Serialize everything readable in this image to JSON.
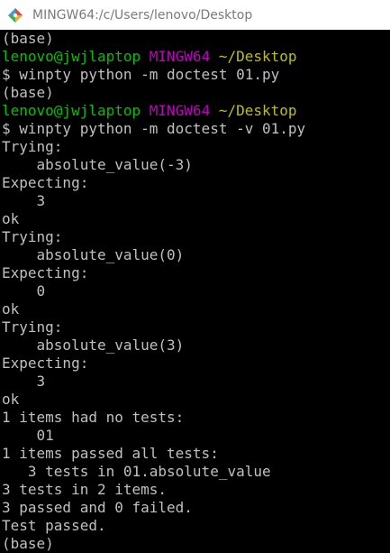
{
  "window": {
    "title": "MINGW64:/c/Users/lenovo/Desktop",
    "icon": "git-bash-icon"
  },
  "terminal": {
    "lines": [
      {
        "kind": "plain",
        "text": "(base)"
      },
      {
        "kind": "prompt",
        "user": "lenovo@jwjlaptop",
        "env": "MINGW64",
        "path": "~/Desktop"
      },
      {
        "kind": "plain",
        "text": "$ winpty python -m doctest 01.py"
      },
      {
        "kind": "plain",
        "text": "(base)"
      },
      {
        "kind": "prompt",
        "user": "lenovo@jwjlaptop",
        "env": "MINGW64",
        "path": "~/Desktop"
      },
      {
        "kind": "plain",
        "text": "$ winpty python -m doctest -v 01.py"
      },
      {
        "kind": "plain",
        "text": "Trying:"
      },
      {
        "kind": "plain",
        "text": "    absolute_value(-3)"
      },
      {
        "kind": "plain",
        "text": "Expecting:"
      },
      {
        "kind": "plain",
        "text": "    3"
      },
      {
        "kind": "plain",
        "text": "ok"
      },
      {
        "kind": "plain",
        "text": "Trying:"
      },
      {
        "kind": "plain",
        "text": "    absolute_value(0)"
      },
      {
        "kind": "plain",
        "text": "Expecting:"
      },
      {
        "kind": "plain",
        "text": "    0"
      },
      {
        "kind": "plain",
        "text": "ok"
      },
      {
        "kind": "plain",
        "text": "Trying:"
      },
      {
        "kind": "plain",
        "text": "    absolute_value(3)"
      },
      {
        "kind": "plain",
        "text": "Expecting:"
      },
      {
        "kind": "plain",
        "text": "    3"
      },
      {
        "kind": "plain",
        "text": "ok"
      },
      {
        "kind": "plain",
        "text": "1 items had no tests:"
      },
      {
        "kind": "plain",
        "text": "    01"
      },
      {
        "kind": "plain",
        "text": "1 items passed all tests:"
      },
      {
        "kind": "plain",
        "text": "   3 tests in 01.absolute_value"
      },
      {
        "kind": "plain",
        "text": "3 tests in 2 items."
      },
      {
        "kind": "plain",
        "text": "3 passed and 0 failed."
      },
      {
        "kind": "plain",
        "text": "Test passed."
      },
      {
        "kind": "plain",
        "text": "(base)"
      }
    ]
  },
  "colors": {
    "background": "#000000",
    "text": "#c0c0c0",
    "prompt_user": "#00c200",
    "prompt_env": "#c000c0",
    "prompt_path": "#c0c000"
  }
}
